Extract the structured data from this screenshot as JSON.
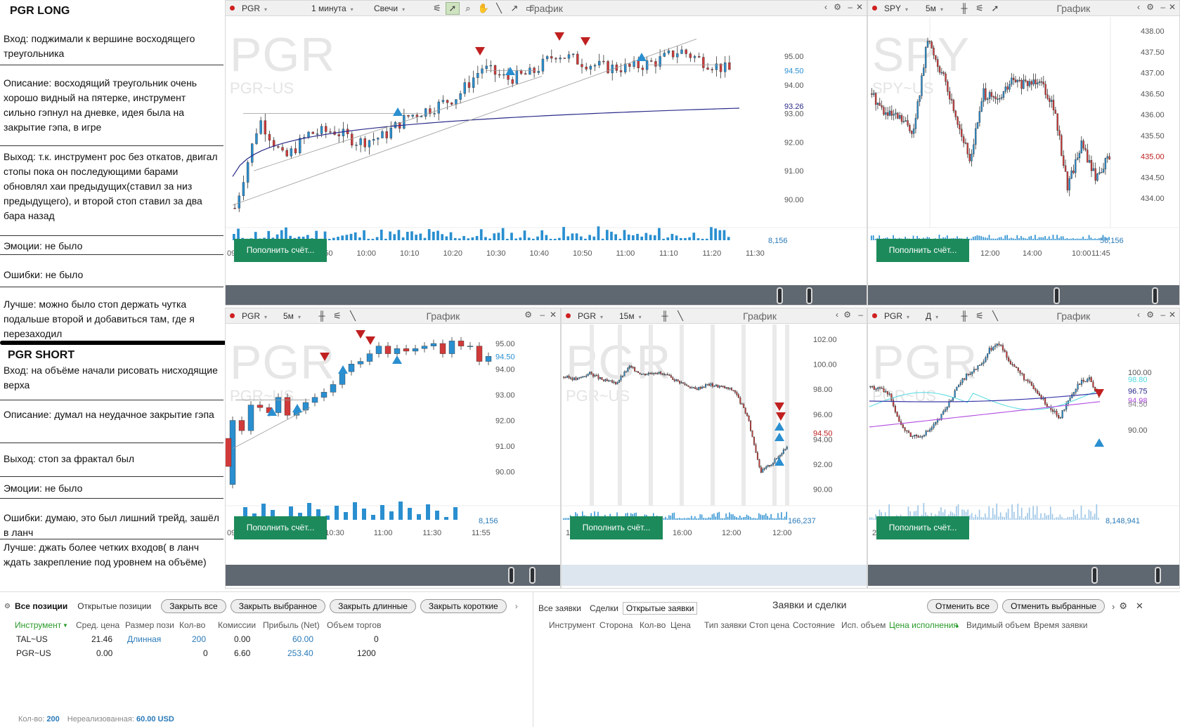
{
  "notes": {
    "long_title": "PGR LONG",
    "long_entry": "Вход: поджимали к вершине восходящего треугольника",
    "long_desc": "Описание: восходящий треугольник очень хорошо видный на пятерке, инструмент сильно гэпнул на дневке, идея была на закрытие гэпа, в игре",
    "long_exit": "Выход: т.к. инструмент рос без откатов, двигал стопы пока он последующими барами обновлял хаи предыдущих(ставил за низ предыдущего), и второй стоп ставил за два бара назад",
    "long_emotions": "Эмоции: не было",
    "long_errors": "Ошибки: не было",
    "long_better": "Лучше: можно было стоп держать чутка подальше второй и добавиться там, где я перезаходил",
    "short_title": "PGR SHORT",
    "short_entry": "Вход: на объёме начали рисовать нисходящие верха",
    "short_desc": "Описание: думал на неудачное закрытие гэпа",
    "short_exit": "Выход: стоп за фрактал был",
    "short_emotions": "Эмоции: не было",
    "short_errors": "Ошибки: думаю, это был лишний трейд, зашёл в ланч",
    "short_better": "Лучше: джать более четких входов( в ланч ждать закрепление под уровнем на объёме)"
  },
  "common": {
    "chart_label": "График",
    "fund_button": "Пополнить счёт..."
  },
  "charts": {
    "c1": {
      "symbol": "PGR",
      "interval": "1 минута",
      "style": "Свечи",
      "wm": "PGR",
      "wm_sub": "PGR~US",
      "y_ticks": [
        "95.00",
        "94.00",
        "93.00",
        "92.00",
        "91.00",
        "90.00"
      ],
      "price_blue": "94.50",
      "price_navy": "93.26",
      "vol_label": "8,156",
      "x_ticks": [
        "09:30",
        "09:40",
        "09:50",
        "10:00",
        "10:10",
        "10:20",
        "10:30",
        "10:40",
        "10:50",
        "11:00",
        "11:10",
        "11:20",
        "11:30"
      ]
    },
    "c2": {
      "symbol": "SPY",
      "interval": "5м",
      "wm": "SPY",
      "wm_sub": "SPY~US",
      "y_ticks": [
        "438.00",
        "437.50",
        "437.00",
        "436.50",
        "436.00",
        "435.50",
        "434.50",
        "434.00"
      ],
      "price_red": "435.00",
      "vol_label": "56,156",
      "x_ticks": [
        "14:00",
        "10:00",
        "12:00",
        "14:00",
        "10:00",
        "11:45"
      ]
    },
    "c3": {
      "symbol": "PGR",
      "interval": "5м",
      "wm": "PGR",
      "wm_sub": "PGR~US",
      "y_ticks": [
        "95.00",
        "94.00",
        "93.00",
        "92.00",
        "91.00",
        "90.00"
      ],
      "price_blue": "94.50",
      "vol_label": "8,156",
      "x_ticks": [
        "09:30",
        "10:00",
        "10:30",
        "11:00",
        "11:30",
        "11:55"
      ]
    },
    "c4": {
      "symbol": "PGR",
      "interval": "15м",
      "wm": "PGR",
      "wm_sub": "PGR~US",
      "y_ticks": [
        "102.00",
        "100.00",
        "98.00",
        "96.00",
        "94.00",
        "92.00",
        "90.00"
      ],
      "price_red": "94.50",
      "vol_label": "166,237",
      "x_ticks": [
        "12:00",
        "12:00",
        "16:00",
        "12:00",
        "12:00"
      ]
    },
    "c5": {
      "symbol": "PGR",
      "interval": "Д",
      "wm": "PGR",
      "wm_sub": "PGR~US",
      "y_ticks": [
        "100.00",
        "90.00"
      ],
      "price_cyan": "98.80",
      "price_navy": "96.75",
      "price_purple": "94.98",
      "price_gray": "94.50",
      "vol_label": "8,148,941",
      "x_ticks": [
        "24 Dec"
      ]
    }
  },
  "positions": {
    "tab_all": "Все позиции",
    "tab_open": "Открытые позиции",
    "btn_close_all": "Закрыть все",
    "btn_close_sel": "Закрыть выбранное",
    "btn_close_long": "Закрыть длинные",
    "btn_close_short": "Закрыть короткие",
    "headers": [
      "Инструмент",
      "Сред. цена",
      "Размер пози",
      "Кол-во",
      "Комиссии",
      "Прибыль (Net)",
      "Объем торгов"
    ],
    "rows": [
      {
        "inst": "TAL~US",
        "avg": "21.46",
        "side": "Длинная",
        "qty": "200",
        "comm": "0.00",
        "pnl": "60.00",
        "vol": "0"
      },
      {
        "inst": "PGR~US",
        "avg": "0.00",
        "side": "",
        "qty": "0",
        "comm": "6.60",
        "pnl": "253.40",
        "vol": "1200"
      }
    ],
    "footer_qty_label": "Кол-во:",
    "footer_qty": "200",
    "footer_unrl_label": "Нереализованная:",
    "footer_unrl": "60.00 USD"
  },
  "orders": {
    "tab_all": "Все заявки",
    "tab_trades": "Сделки",
    "tab_open": "Открытые заявки",
    "title": "Заявки и сделки",
    "btn_cancel_all": "Отменить все",
    "btn_cancel_sel": "Отменить выбранные",
    "headers": [
      "Инструмент",
      "Сторона",
      "Кол-во",
      "Цена",
      "Тип заявки",
      "Стоп цена",
      "Состояние",
      "Исп. объем",
      "Цена исполнения",
      "Видимый объем",
      "Время заявки"
    ]
  }
}
